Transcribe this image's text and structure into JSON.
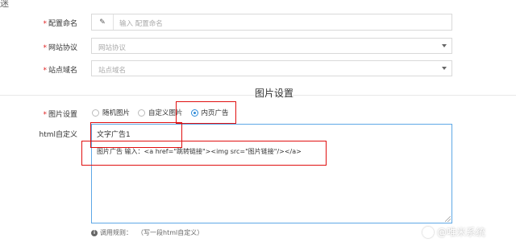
{
  "top_fragment": "ﾠ",
  "form": {
    "config_name": {
      "label": "配置命名",
      "placeholder": "输入 配置命名",
      "prefix_icon": "pencil-icon"
    },
    "protocol": {
      "label": "网站协议",
      "placeholder": "网站协议"
    },
    "domain": {
      "label": "站点域名",
      "placeholder": "站点域名"
    }
  },
  "image_section": {
    "title": "图片设置",
    "label": "图片设置",
    "options": [
      "随机图片",
      "自定义图片",
      "内页广告"
    ],
    "selected": "内页广告"
  },
  "html_custom": {
    "label": "html自定义",
    "line1": "文字广告1",
    "line2": "图片广告 输入：<a href=\"跳转链接\"><img src=\"图片链接\"/></a>"
  },
  "hint": {
    "icon": "info-icon",
    "prefix": "调用规则：",
    "text": "（写一段html自定义）"
  },
  "watermark": "@唯米系统",
  "colors": {
    "required": "#e02020",
    "accent": "#2b8ad8",
    "highlight": "#e01010"
  }
}
